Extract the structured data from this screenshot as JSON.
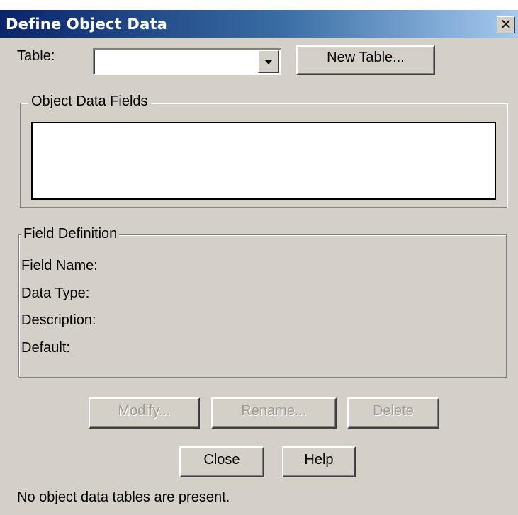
{
  "dialog": {
    "title": "Define Object Data",
    "close_icon": "✕"
  },
  "table_row": {
    "label": "Table:",
    "selected_value": "",
    "new_table_button": "New Table..."
  },
  "object_data_fields": {
    "legend": "Object Data Fields",
    "items": []
  },
  "field_definition": {
    "legend": "Field Definition",
    "field_name_label": "Field Name:",
    "data_type_label": "Data Type:",
    "description_label": "Description:",
    "default_label": "Default:"
  },
  "actions": {
    "modify": "Modify...",
    "rename": "Rename...",
    "delete": "Delete",
    "close": "Close",
    "help": "Help"
  },
  "status": {
    "message": "No object data tables are present."
  }
}
